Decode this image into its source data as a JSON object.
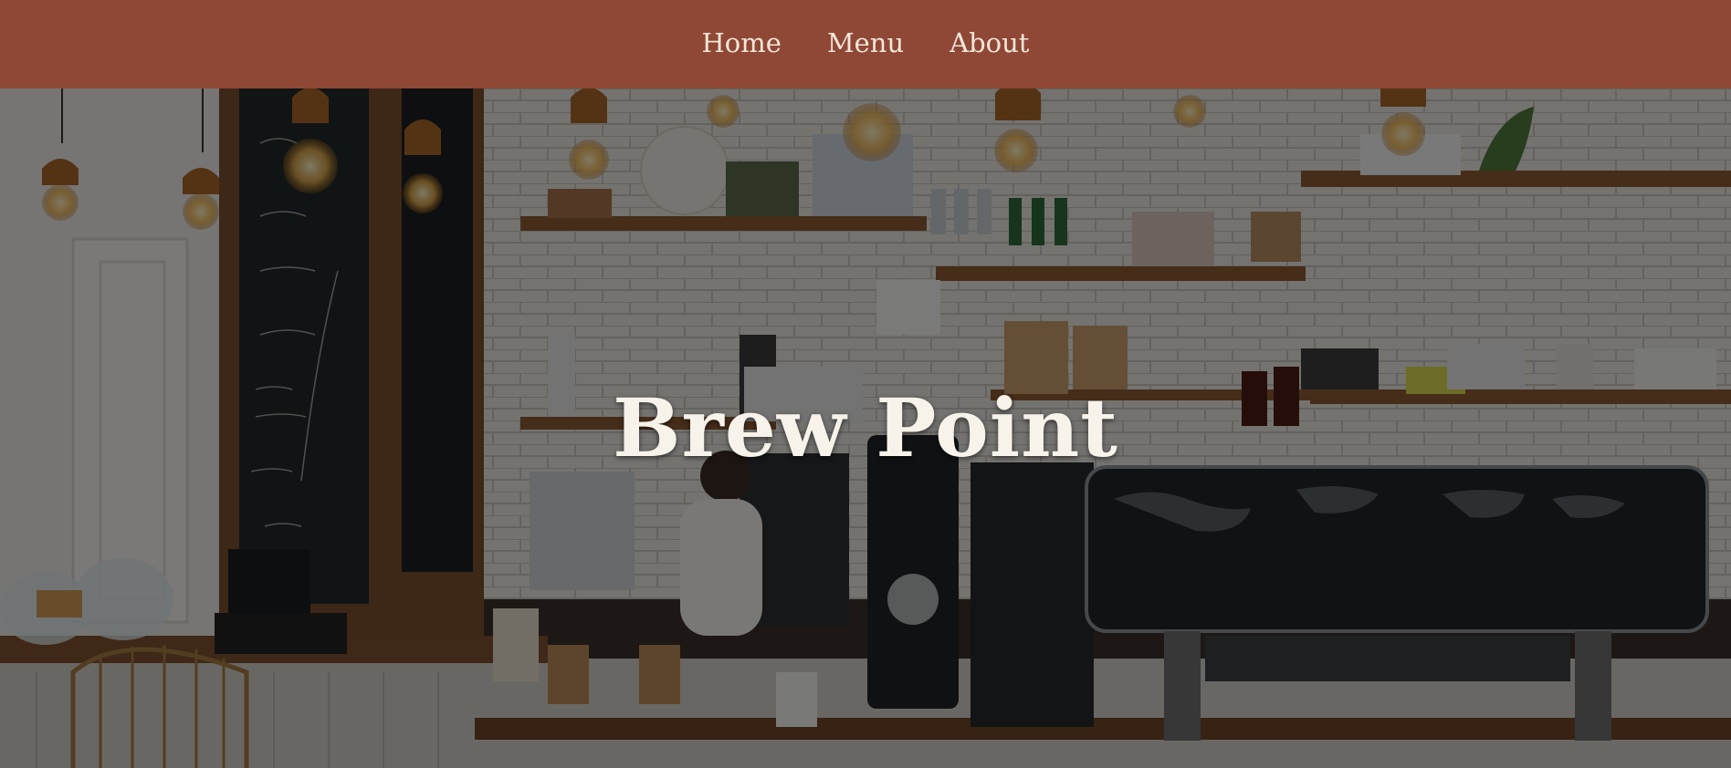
{
  "nav": {
    "items": [
      {
        "label": "Home"
      },
      {
        "label": "Menu"
      },
      {
        "label": "About"
      }
    ]
  },
  "hero": {
    "title": "Brew Point",
    "image_description_icon": "coffee-shop-interior-photo"
  },
  "colors": {
    "navbar_bg": "#8f4736",
    "nav_text": "#f3e6d8",
    "title_text": "#f7f2ea"
  }
}
